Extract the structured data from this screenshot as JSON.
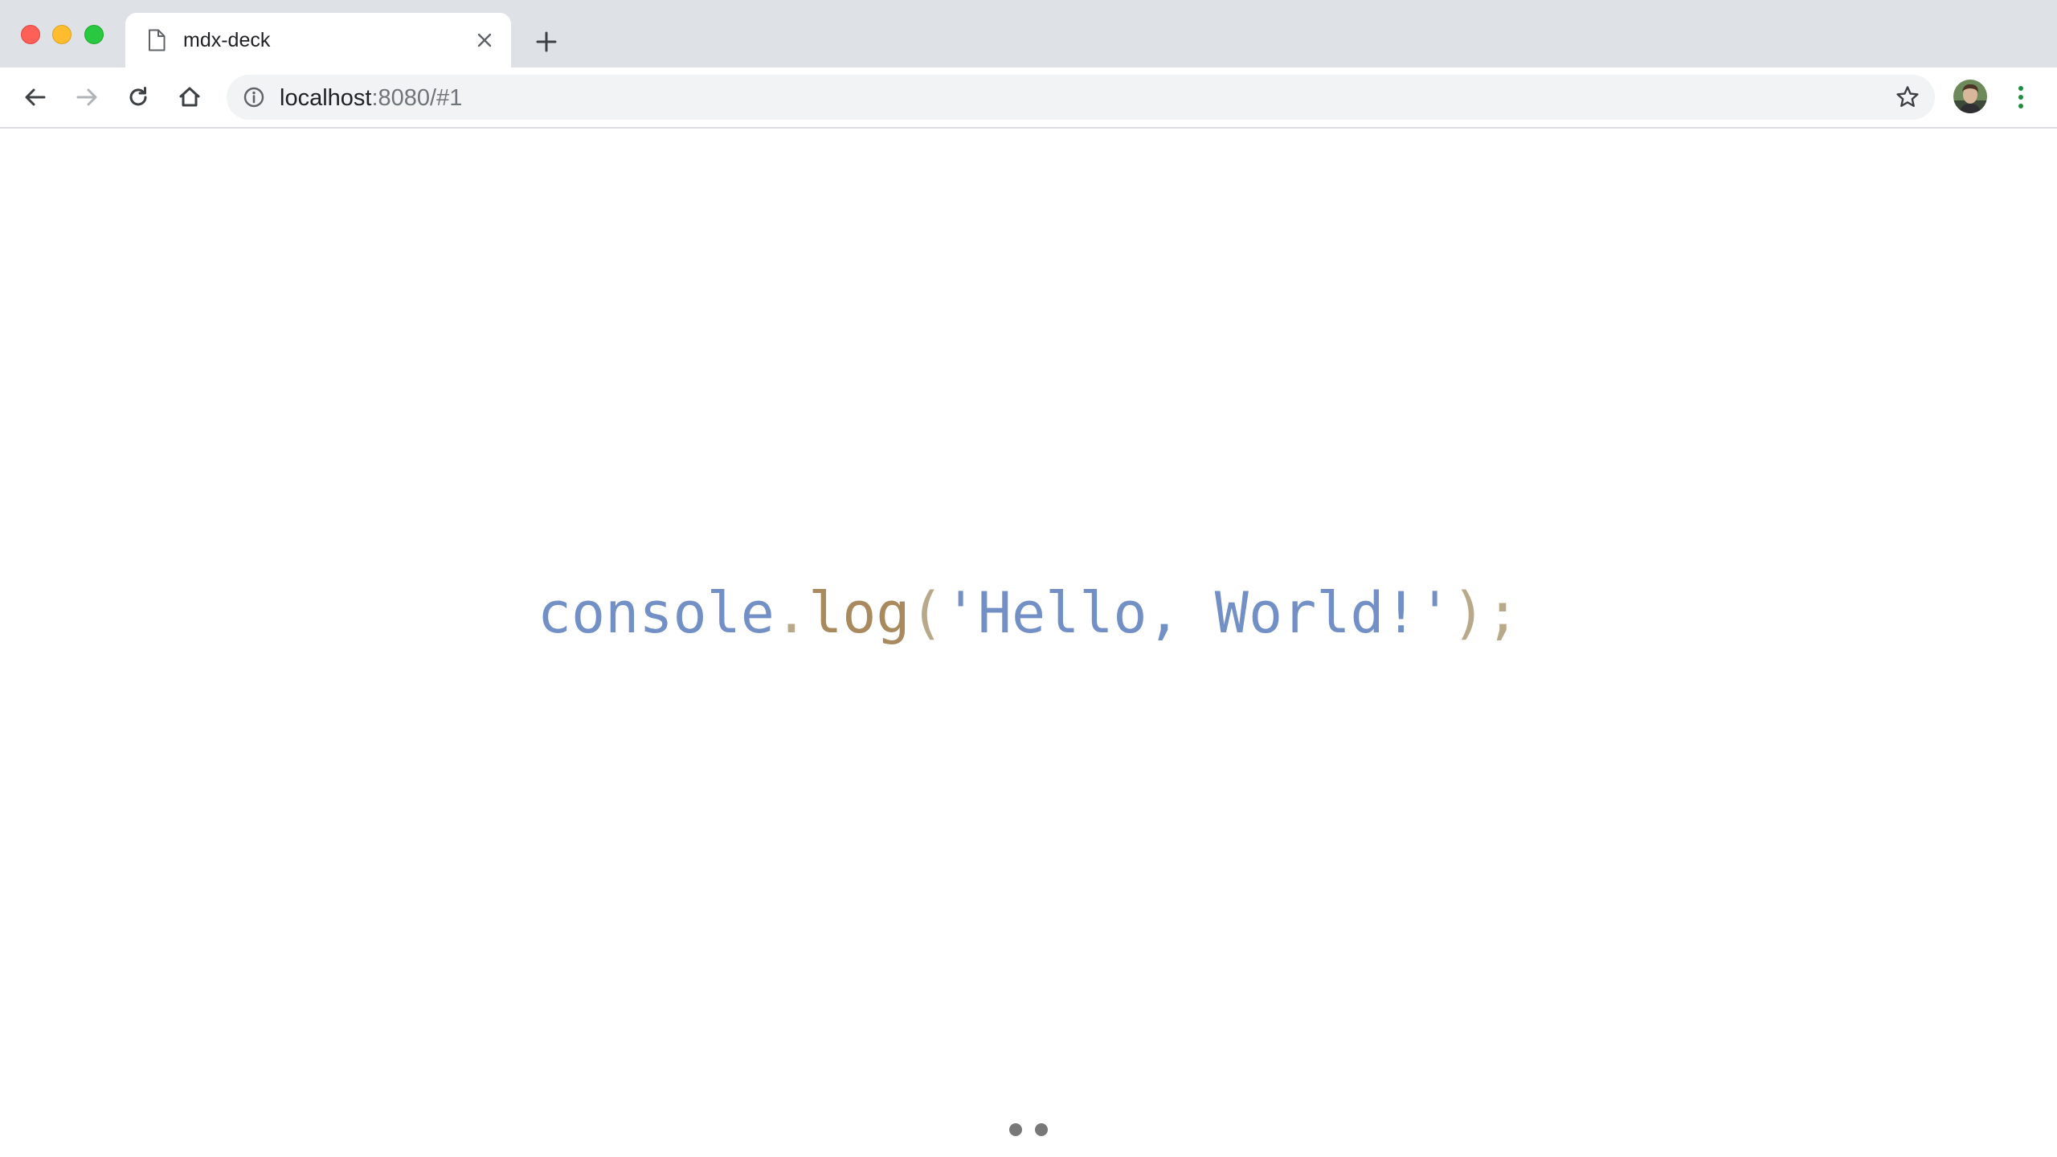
{
  "browser": {
    "tab": {
      "title": "mdx-deck",
      "icon": "document-icon"
    },
    "address": {
      "host": "localhost",
      "rest": ":8080/#1"
    },
    "colors": {
      "tabstrip": "#dee1e6",
      "close": "#fe5f57",
      "minimize": "#febc2e",
      "maximize": "#28c840",
      "menu_dots": "#1e8e3e"
    }
  },
  "slide": {
    "code": {
      "language": "javascript",
      "tokens": [
        {
          "text": "console",
          "kind": "identifier"
        },
        {
          "text": ".",
          "kind": "punctuation"
        },
        {
          "text": "log",
          "kind": "function"
        },
        {
          "text": "(",
          "kind": "punctuation"
        },
        {
          "text": "'Hello, World!'",
          "kind": "string"
        },
        {
          "text": ");",
          "kind": "punctuation"
        }
      ],
      "colors": {
        "identifier": "#7390c6",
        "function": "#a88a5e",
        "punctuation": "#b8a98b",
        "string": "#7390c6"
      }
    },
    "pagination": {
      "total_slides": 2,
      "current_index": 1
    }
  }
}
